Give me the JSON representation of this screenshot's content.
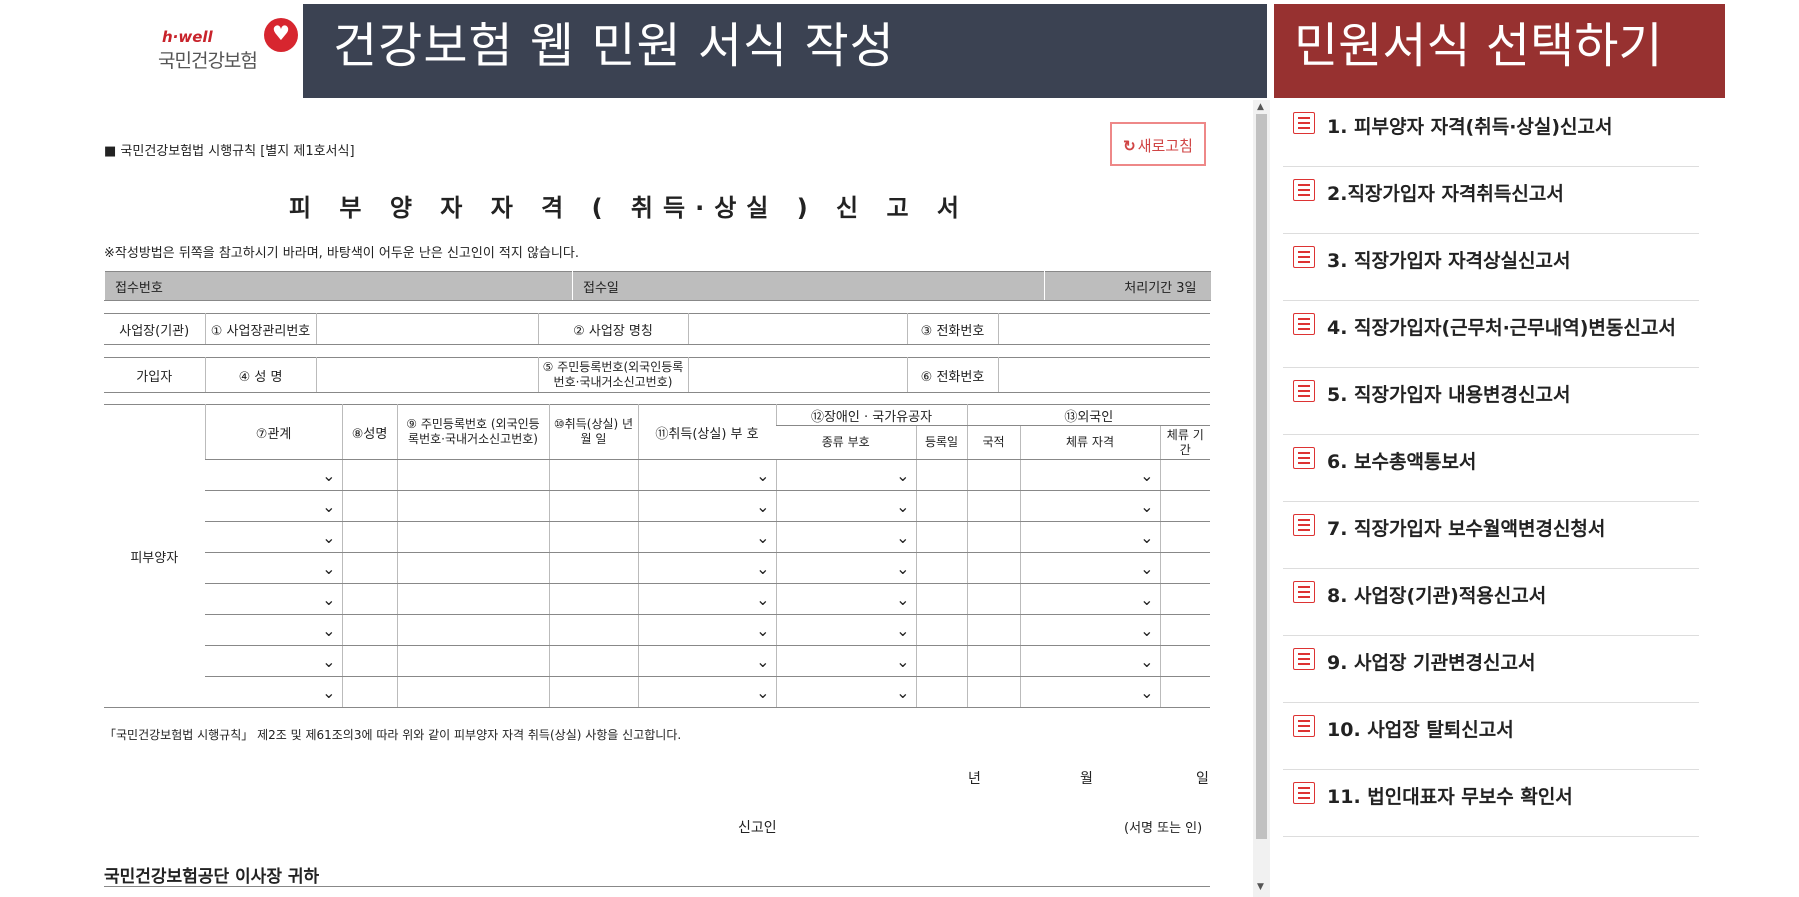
{
  "header": {
    "logo_small": "h·well",
    "logo_brand": "국민건강보험",
    "title": "건강보험 웹 민원 서식 작성",
    "select_title": "민원서식 선택하기",
    "colors": {
      "title_bg": "#3b4252",
      "select_bg": "#973130",
      "accent": "#d33"
    }
  },
  "form": {
    "law_ref": "■ 국민건강보험법 시행규칙 [별지 제1호서식]",
    "refresh_label": "새로고침",
    "refresh_icon": "refresh-icon",
    "title": "피 부 양 자 자 격 ( 취득·상실 ) 신 고 서",
    "note": "※작성방법은 뒤쪽을 참고하시기 바라며, 바탕색이 어두운 난은 신고인이 적지 않습니다.",
    "receipt": {
      "number": "접수번호",
      "date": "접수일",
      "period": "처리기간  3일"
    },
    "business": {
      "label": "사업장(기관)",
      "mgmt_no": "① 사업장관리번호",
      "name": "② 사업장 명칭",
      "phone": "③ 전화번호"
    },
    "subscriber": {
      "label": "가입자",
      "name": "④ 성 명",
      "rrn": "⑤ 주민등록번호(외국인등록번호·국내거소신고번호)",
      "phone": "⑥ 전화번호"
    },
    "dependents": {
      "label": "피부양자",
      "col_relation": "⑦관계",
      "col_name": "⑧성명",
      "col_rrn": "⑨ 주민등록번호 (외국인등록번호·국내거소신고번호)",
      "col_date": "⑩취득(상실) 년 월 일",
      "col_code": "⑪취득(상실) 부 호",
      "col_disabled": "⑫장애인 · 국가유공자",
      "col_type": "종류 부호",
      "col_regdate": "등록일",
      "col_foreign": "⑬외국인",
      "col_nation": "국적",
      "col_status": "체류 자격",
      "col_period": "체류 기간",
      "row_count": 8
    },
    "confirm_text": "「국민건강보험법 시행규칙」 제2조 및 제61조의3에 따라 위와 같이 피부양자 자격 취득(상실) 사항을 신고합니다.",
    "date_year": "년",
    "date_month": "월",
    "date_day": "일",
    "reporter": "신고인",
    "sign": "(서명 또는 인)",
    "addressee": "국민건강보험공단 이사장 귀하"
  },
  "sidebar": {
    "items": [
      {
        "label": "1. 피부양자 자격(취득·상실)신고서",
        "icon": "list-document-icon"
      },
      {
        "label": "2.직장가입자 자격취득신고서",
        "icon": "list-document-icon"
      },
      {
        "label": "3. 직장가입자 자격상실신고서",
        "icon": "list-document-icon"
      },
      {
        "label": "4. 직장가입자(근무처·근무내역)변동신고서",
        "icon": "list-document-icon"
      },
      {
        "label": "5. 직장가입자 내용변경신고서",
        "icon": "list-document-icon"
      },
      {
        "label": "6. 보수총액통보서",
        "icon": "list-document-icon"
      },
      {
        "label": "7. 직장가입자 보수월액변경신청서",
        "icon": "list-document-icon"
      },
      {
        "label": "8. 사업장(기관)적용신고서",
        "icon": "list-document-icon"
      },
      {
        "label": "9. 사업장 기관변경신고서",
        "icon": "list-document-icon"
      },
      {
        "label": "10. 사업장 탈퇴신고서",
        "icon": "list-document-icon"
      },
      {
        "label": "11. 법인대표자 무보수 확인서",
        "icon": "list-document-icon"
      }
    ]
  }
}
